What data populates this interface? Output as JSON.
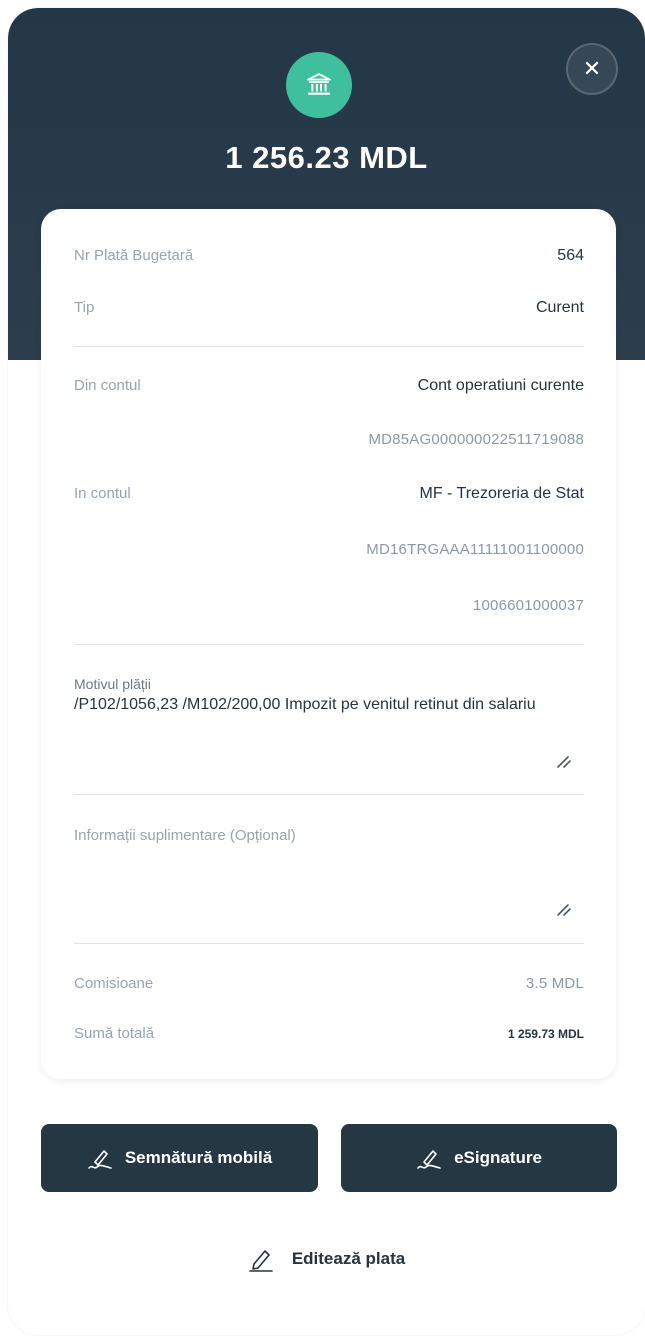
{
  "header": {
    "amount": "1 256.23 MDL",
    "icon": "bank-building-icon",
    "badge_color": "#3fbf9e",
    "header_color": "#243746"
  },
  "details": {
    "nr_plata_label": "Nr Plată Bugetară",
    "nr_plata_value": "564",
    "tip_label": "Tip",
    "tip_value": "Curent",
    "din_contul_label": "Din contul",
    "din_contul_name": "Cont operatiuni curente",
    "din_contul_iban": "MD85AG000000022511719088",
    "in_contul_label": "In contul",
    "in_contul_name": "MF - Trezoreria de Stat",
    "in_contul_iban": "MD16TRGAAA11111001100000",
    "in_contul_code": "1006601000037",
    "motiv_label": "Motivul plății",
    "motiv_text": "/P102/1056,23 /M102/200,00 Impozit pe venitul retinut din salariu",
    "info_label": "Informații suplimentare (Opțional)",
    "comisioane_label": "Comisioane",
    "comisioane_value": "3.5 MDL",
    "suma_label": "Sumă totală",
    "suma_value": "1 259.73 MDL"
  },
  "actions": {
    "mobile_signature": "Semnătură mobilă",
    "esignature": "eSignature",
    "edit_payment": "Editează plata"
  }
}
